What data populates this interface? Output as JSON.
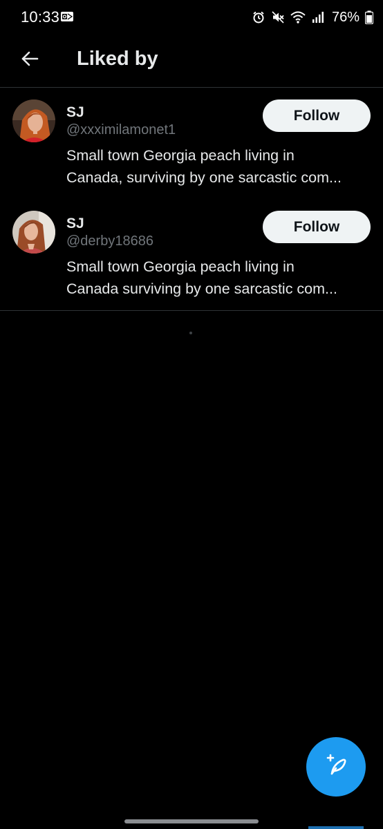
{
  "status_bar": {
    "time": "10:33",
    "battery": "76%",
    "icons": [
      "outlook-mail-icon",
      "alarm-icon",
      "mute-icon",
      "wifi-icon",
      "signal-icon",
      "battery-icon"
    ]
  },
  "header": {
    "back_icon": "arrow-left-icon",
    "title": "Liked by"
  },
  "users": [
    {
      "name": "SJ",
      "handle": "@xxximilamonet1",
      "bio_line1": "Small town Georgia peach living in",
      "bio_line2": "Canada, surviving by one sarcastic com...",
      "follow_label": "Follow"
    },
    {
      "name": "SJ",
      "handle": "@derby18686",
      "bio_line1": "Small town Georgia peach living in",
      "bio_line2": "Canada surviving by one sarcastic com...",
      "follow_label": "Follow"
    }
  ],
  "compose": {
    "icon": "compose-feather-icon"
  },
  "colors": {
    "background": "#000000",
    "text_primary": "#e7e9ea",
    "text_secondary": "#71767b",
    "divider": "#2f3336",
    "accent": "#1d9bf0",
    "follow_button_bg": "#eff3f4"
  }
}
